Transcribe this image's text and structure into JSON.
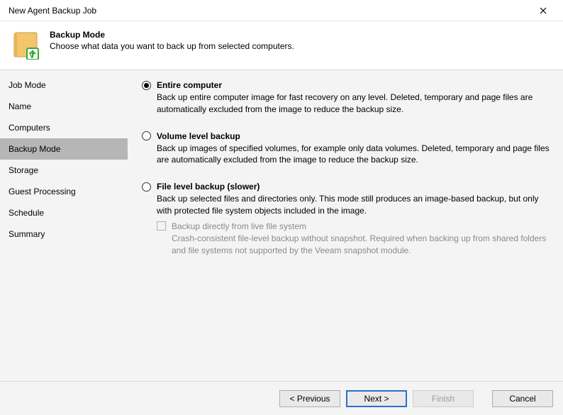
{
  "window": {
    "title": "New Agent Backup Job"
  },
  "header": {
    "title": "Backup Mode",
    "subtitle": "Choose what data you want to back up from selected computers."
  },
  "sidebar": {
    "items": [
      {
        "label": "Job Mode"
      },
      {
        "label": "Name"
      },
      {
        "label": "Computers"
      },
      {
        "label": "Backup Mode"
      },
      {
        "label": "Storage"
      },
      {
        "label": "Guest Processing"
      },
      {
        "label": "Schedule"
      },
      {
        "label": "Summary"
      }
    ]
  },
  "options": {
    "entire": {
      "title": "Entire computer",
      "desc": "Back up entire computer image for fast recovery on any level. Deleted, temporary and page files are automatically excluded from the image to reduce the backup size."
    },
    "volume": {
      "title": "Volume level backup",
      "desc": "Back up images of specified volumes, for example only data volumes. Deleted, temporary and page files are automatically excluded from the image to reduce the backup size."
    },
    "file": {
      "title": "File level backup (slower)",
      "desc": "Back up selected files and directories only. This mode still produces an image-based backup, but only with protected file system objects included in the image.",
      "sub": {
        "label": "Backup directly from live file system",
        "desc": "Crash-consistent file-level backup without snapshot. Required when backing up from shared folders and file systems not supported by the Veeam snapshot module."
      }
    }
  },
  "footer": {
    "previous": "< Previous",
    "next": "Next >",
    "finish": "Finish",
    "cancel": "Cancel"
  }
}
